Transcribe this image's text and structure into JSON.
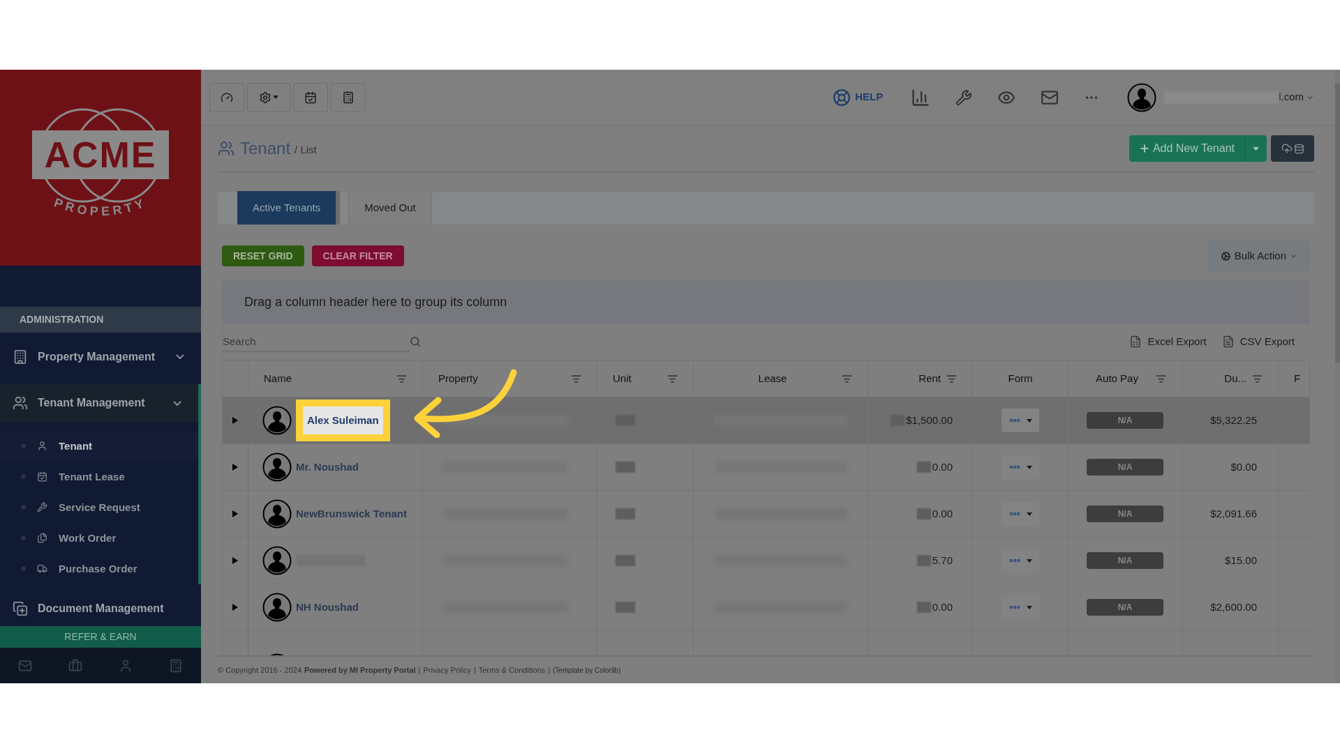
{
  "sidebar": {
    "logo": {
      "word": "ACME",
      "sub": "PROPERTY"
    },
    "section": "ADMINISTRATION",
    "menus": [
      {
        "label": "Property Management",
        "selected": false
      },
      {
        "label": "Tenant Management",
        "selected": true,
        "children": [
          {
            "label": "Tenant",
            "selected": true
          },
          {
            "label": "Tenant Lease",
            "selected": false
          },
          {
            "label": "Service Request",
            "selected": false
          },
          {
            "label": "Work Order",
            "selected": false
          },
          {
            "label": "Purchase Order",
            "selected": false
          }
        ]
      },
      {
        "label": "Document Management",
        "selected": false
      }
    ],
    "refer": "REFER & EARN"
  },
  "topbar": {
    "help": "HELP",
    "user_email": "l.com"
  },
  "page": {
    "title": "Tenant",
    "crumb": "/ List",
    "add_button": "Add New Tenant"
  },
  "tabs": [
    {
      "label": "Active Tenants",
      "selected": true
    },
    {
      "label": "Moved Out",
      "selected": false
    }
  ],
  "buttons": {
    "reset": "RESET GRID",
    "clear": "CLEAR FILTER",
    "bulk": "Bulk Action"
  },
  "group_panel": "Drag a column header here to group its column",
  "search": {
    "placeholder": "Search"
  },
  "exports": [
    "Excel Export",
    "CSV Export"
  ],
  "table": {
    "columns": [
      {
        "label": "Name",
        "filter": true
      },
      {
        "label": "Property",
        "filter": true
      },
      {
        "label": "Unit",
        "filter": true
      },
      {
        "label": "Lease",
        "filter": true
      },
      {
        "label": "Rent",
        "filter": true
      },
      {
        "label": "Form",
        "filter": false
      },
      {
        "label": "Auto Pay",
        "filter": true
      },
      {
        "label": "Du...",
        "filter": true
      },
      {
        "label": "F",
        "filter": false
      }
    ],
    "rows": [
      {
        "name": "Alex Suleiman",
        "highlighted": true,
        "rent": "$1,500.00",
        "autopay": "N/A",
        "due": "$5,322.25"
      },
      {
        "name": "Mr. Noushad",
        "highlighted": false,
        "rent": "0.00",
        "autopay": "N/A",
        "due": "$0.00"
      },
      {
        "name": "NewBrunswick Tenant",
        "highlighted": false,
        "rent": "0.00",
        "autopay": "N/A",
        "due": "$2,091.66"
      },
      {
        "highlighted": false,
        "rent": "5.70",
        "autopay": "N/A",
        "due": "$15.00"
      },
      {
        "name": "NH Noushad",
        "highlighted": false,
        "rent": "0.00",
        "autopay": "N/A",
        "due": "$2,600.00"
      }
    ]
  },
  "footer": [
    {
      "kind": "text",
      "text": "© Copyright 2016 - 2024"
    },
    {
      "kind": "bold",
      "text": "Powered by MI Property Portal"
    },
    {
      "kind": "sep",
      "text": "|"
    },
    {
      "kind": "link",
      "text": "Privacy Policy"
    },
    {
      "kind": "sep",
      "text": "|"
    },
    {
      "kind": "link",
      "text": "Terms & Conditions"
    },
    {
      "kind": "sep",
      "text": "|"
    },
    {
      "kind": "small",
      "text": "(Template by Colorlib)"
    }
  ]
}
